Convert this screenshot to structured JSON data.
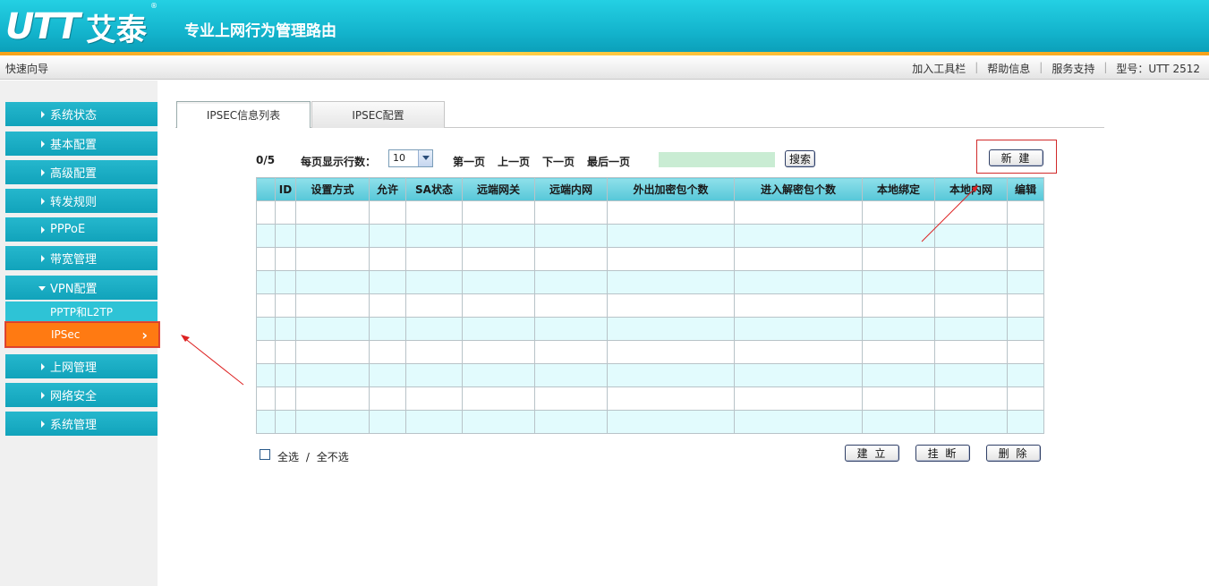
{
  "header": {
    "logo_mark": "UTT",
    "logo_cn": "艾泰",
    "logo_reg": "®",
    "slogan": "专业上网行为管理路由"
  },
  "topbar": {
    "wizard": "快速向导",
    "links": [
      "加入工具栏",
      "帮助信息",
      "服务支持",
      "型号：UTT 2512"
    ]
  },
  "sidebar": {
    "items": [
      {
        "label": "系统状态"
      },
      {
        "label": "基本配置"
      },
      {
        "label": "高级配置"
      },
      {
        "label": "转发规则"
      },
      {
        "label": "PPPoE"
      },
      {
        "label": "带宽管理"
      },
      {
        "label": "VPN配置",
        "expanded": true
      },
      {
        "label": "上网管理"
      },
      {
        "label": "网络安全"
      },
      {
        "label": "系统管理"
      }
    ],
    "vpn_sub": [
      "PPTP和L2TP",
      "IPSec"
    ],
    "active_sub": "IPSec",
    "colors": {
      "menu": "#1aadc4",
      "active": "#ff7a12"
    }
  },
  "tabs": [
    "IPSEC信息列表",
    "IPSEC配置"
  ],
  "controls": {
    "count": "0/5",
    "rows_label": "每页显示行数：",
    "rows_value": "10",
    "first": "第一页",
    "prev": "上一页",
    "next": "下一页",
    "last": "最后一页",
    "search_button": "搜索",
    "new_button": "新 建"
  },
  "table": {
    "headers": [
      "",
      "ID",
      "设置方式",
      "允许",
      "SA状态",
      "远端网关",
      "远端内网",
      "外出加密包个数",
      "进入解密包个数",
      "本地绑定",
      "本地内网",
      "编辑"
    ],
    "row_count": 10
  },
  "footer": {
    "select_all": "全选",
    "divider": "/",
    "select_none": "全不选",
    "buttons": [
      "建 立",
      "挂 断",
      "删 除"
    ]
  }
}
